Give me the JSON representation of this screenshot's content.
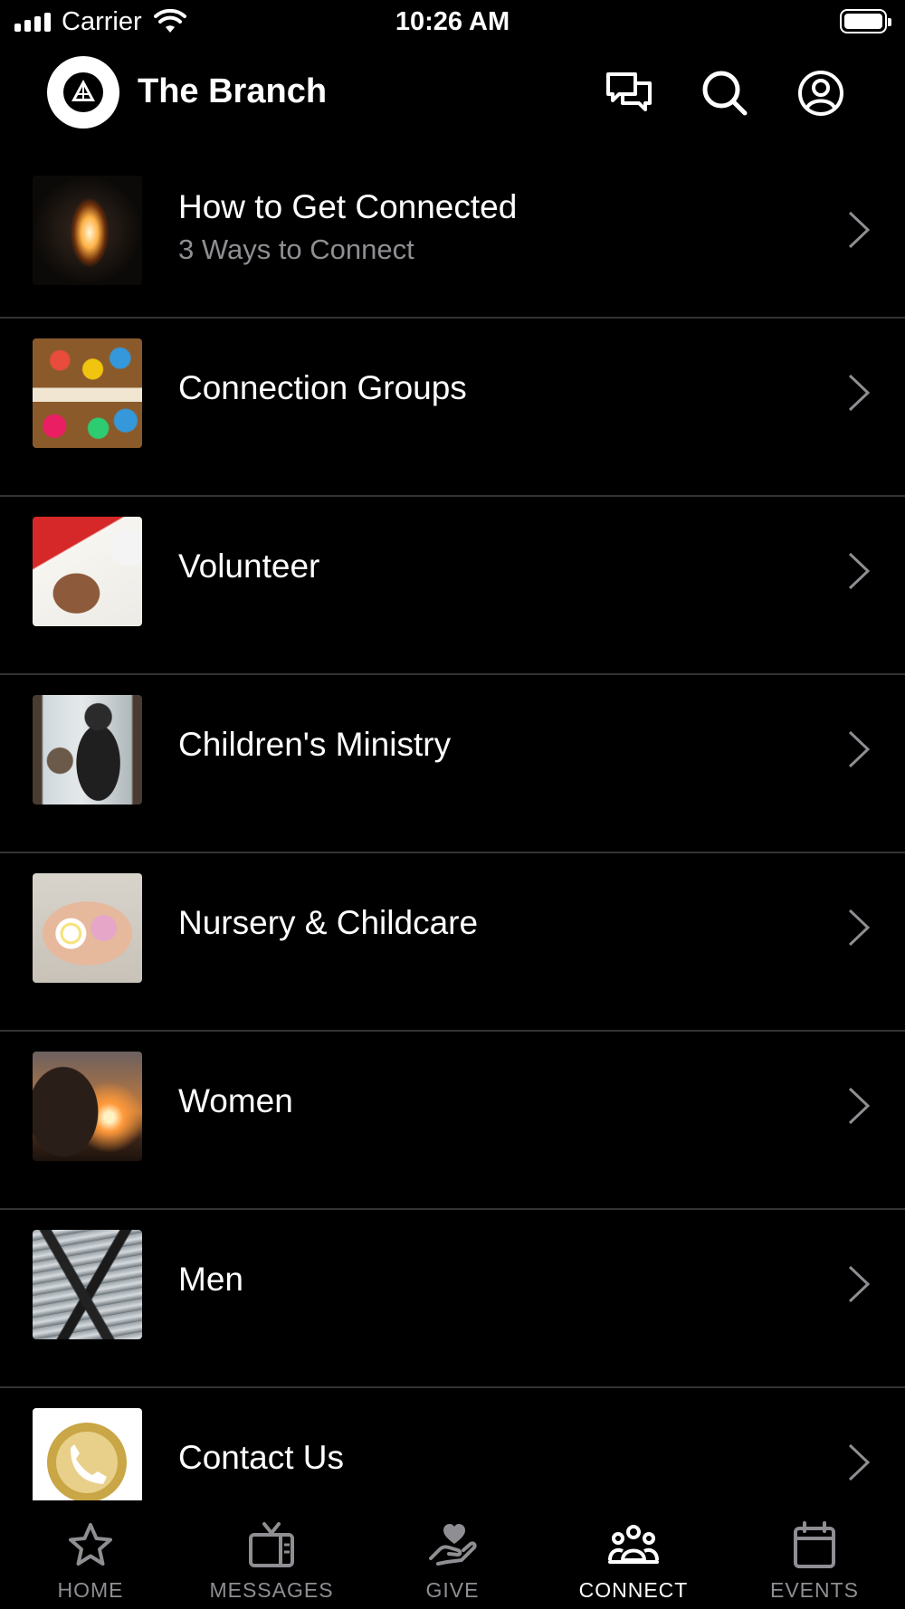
{
  "status_bar": {
    "carrier": "Carrier",
    "time": "10:26 AM"
  },
  "header": {
    "title": "The Branch",
    "icons": [
      "chat-icon",
      "search-icon",
      "profile-icon"
    ]
  },
  "list": [
    {
      "title": "How to Get Connected",
      "subtitle": "3 Ways to Connect",
      "thumb": "fire-in-cave"
    },
    {
      "title": "Connection Groups",
      "thumb": "friends-blocks"
    },
    {
      "title": "Volunteer",
      "thumb": "hand-writing"
    },
    {
      "title": "Children's Ministry",
      "thumb": "kids-at-window"
    },
    {
      "title": "Nursery & Childcare",
      "thumb": "hands-flowers"
    },
    {
      "title": "Women",
      "thumb": "woman-sunset"
    },
    {
      "title": "Men",
      "thumb": "man-on-ledge"
    },
    {
      "title": "Contact Us",
      "thumb": "phone-circle"
    }
  ],
  "tabs": [
    {
      "label": "HOME",
      "icon": "star-icon",
      "active": false
    },
    {
      "label": "MESSAGES",
      "icon": "tv-icon",
      "active": false
    },
    {
      "label": "GIVE",
      "icon": "heart-hand-icon",
      "active": false
    },
    {
      "label": "CONNECT",
      "icon": "people-icon",
      "active": true
    },
    {
      "label": "EVENTS",
      "icon": "calendar-icon",
      "active": false
    }
  ],
  "colors": {
    "background": "#000000",
    "text": "#ffffff",
    "muted": "#8e8e93",
    "divider": "#333333"
  }
}
